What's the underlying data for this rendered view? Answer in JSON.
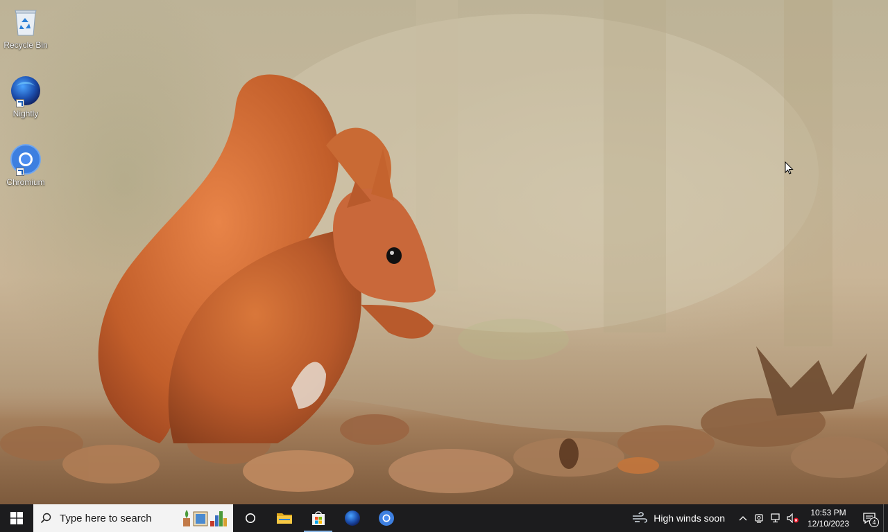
{
  "desktop": {
    "icons": [
      {
        "label": "Recycle Bin",
        "icon": "recycle-bin-icon"
      },
      {
        "label": "Nightly",
        "icon": "firefox-nightly-icon"
      },
      {
        "label": "Chromium",
        "icon": "chromium-icon"
      }
    ]
  },
  "taskbar": {
    "search_placeholder": "Type here to search",
    "pinned": [
      {
        "name": "task-view",
        "icon": "task-view-icon"
      },
      {
        "name": "file-explorer",
        "icon": "folder-icon"
      },
      {
        "name": "microsoft-store",
        "icon": "store-icon"
      },
      {
        "name": "nightly",
        "icon": "firefox-nightly-icon"
      },
      {
        "name": "chromium",
        "icon": "chromium-icon"
      }
    ],
    "weather_text": "High winds soon",
    "clock": {
      "time": "10:53 PM",
      "date": "12/10/2023"
    },
    "notification_count": "4"
  },
  "colors": {
    "taskbar_bg": "#1c1c1e",
    "search_bg": "#f3f3f3",
    "accent": "#8ab8e8"
  }
}
